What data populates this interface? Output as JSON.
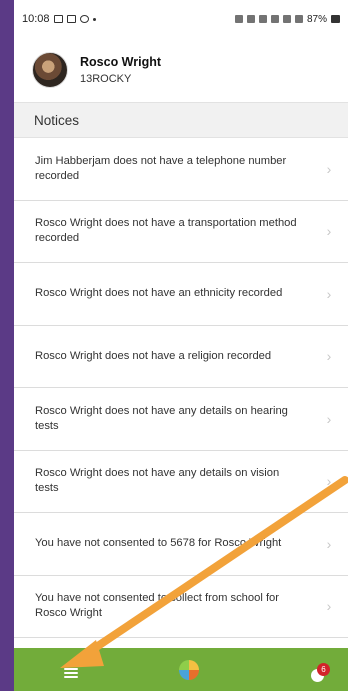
{
  "status_bar": {
    "time": "10:08",
    "battery": "87%"
  },
  "profile": {
    "name": "Rosco Wright",
    "handle": "13ROCKY"
  },
  "notices": {
    "header": "Notices",
    "items": [
      "Jim Habberjam does not have a telephone number recorded",
      "Rosco Wright does not have a transportation method recorded",
      "Rosco Wright does not have an ethnicity recorded",
      "Rosco Wright does not have a religion recorded",
      "Rosco Wright does not have any details on hearing tests",
      "Rosco Wright does not have any details on vision tests",
      "You have not consented to 5678 for Rosco Wright",
      "You have not consented to collect from school for Rosco Wright"
    ]
  },
  "bottom_nav": {
    "alert_badge": "6"
  },
  "icons": [
    "menu-icon",
    "logo-icon",
    "alert-icon",
    "chevron-right-icon"
  ],
  "colors": {
    "background": "#5b3a86",
    "nav_green": "#72ac3a",
    "badge_red": "#d2232a",
    "arrow": "#f2a23a"
  }
}
